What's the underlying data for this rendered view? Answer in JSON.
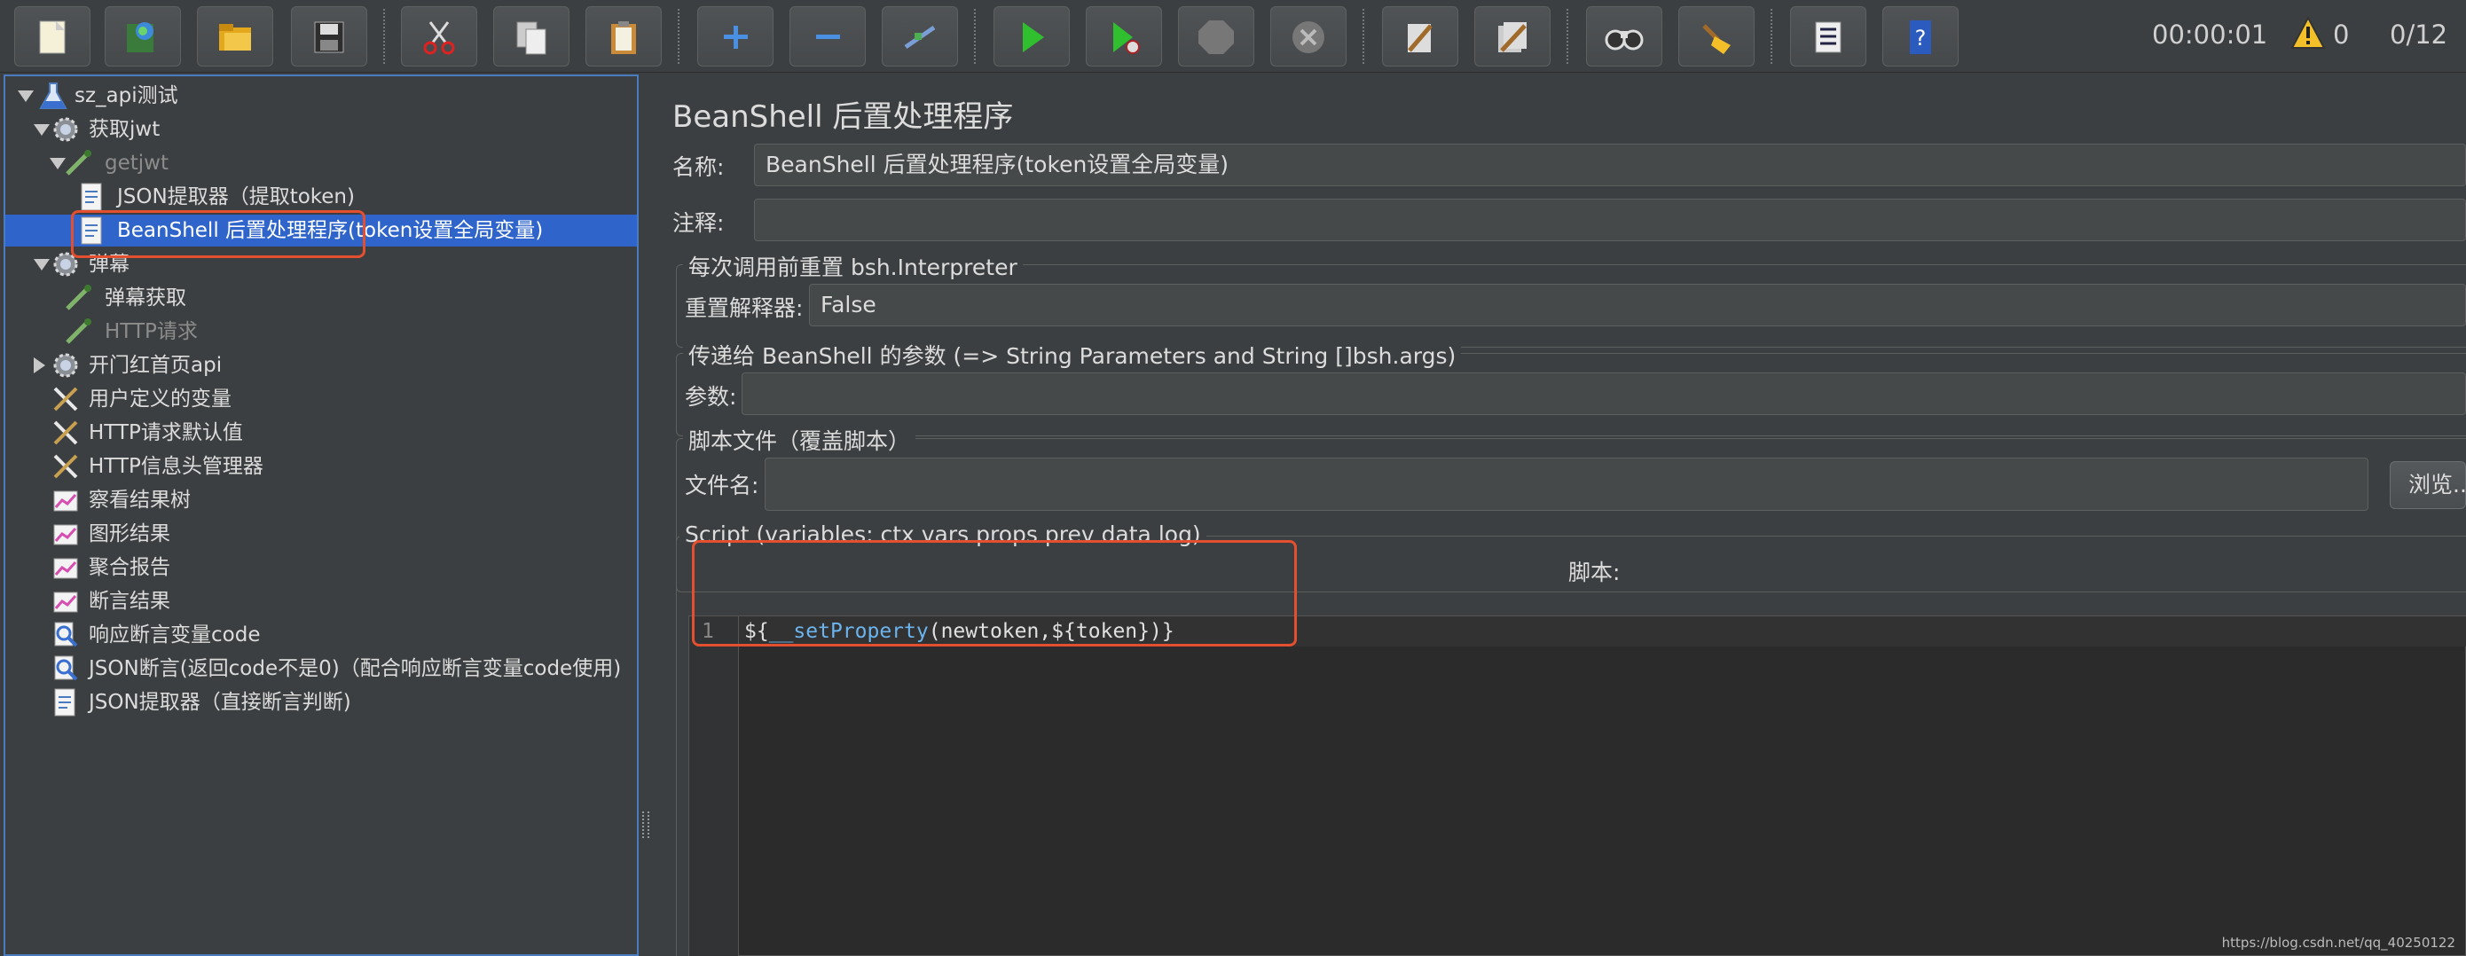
{
  "toolbar": {
    "buttons": [
      {
        "name": "new-plan-button",
        "icon": "new-document-icon"
      },
      {
        "name": "templates-button",
        "icon": "templates-icon"
      },
      {
        "name": "open-button",
        "icon": "open-folder-icon"
      },
      {
        "name": "save-button",
        "icon": "save-disk-icon"
      },
      {
        "name": "cut-button",
        "icon": "scissors-icon"
      },
      {
        "name": "copy-button",
        "icon": "copy-icon"
      },
      {
        "name": "paste-button",
        "icon": "paste-clipboard-icon"
      },
      {
        "name": "expand-button",
        "icon": "plus-icon"
      },
      {
        "name": "collapse-button",
        "icon": "minus-icon"
      },
      {
        "name": "toggle-button",
        "icon": "toggle-wand-icon"
      },
      {
        "name": "start-button",
        "icon": "play-icon"
      },
      {
        "name": "start-no-pauses-button",
        "icon": "play-no-timers-icon"
      },
      {
        "name": "stop-button",
        "icon": "stop-sign-icon"
      },
      {
        "name": "shutdown-button",
        "icon": "shutdown-x-icon"
      },
      {
        "name": "clear-button",
        "icon": "clear-broom-icon"
      },
      {
        "name": "clear-all-button",
        "icon": "clear-all-broom-icon"
      },
      {
        "name": "search-button",
        "icon": "binoculars-icon"
      },
      {
        "name": "reset-search-button",
        "icon": "reset-broom-icon"
      },
      {
        "name": "function-helper-button",
        "icon": "function-list-icon"
      },
      {
        "name": "help-button",
        "icon": "help-book-icon"
      }
    ],
    "timer": "00:00:01",
    "warning_count": "0",
    "threads": "0/12"
  },
  "tree": [
    {
      "label": "sz_api测试",
      "expanded": true,
      "icon": "flask-icon",
      "level": 0,
      "state": "normal"
    },
    {
      "label": "获取jwt",
      "expanded": true,
      "icon": "gear-icon",
      "level": 1,
      "state": "normal"
    },
    {
      "label": "getjwt",
      "expanded": true,
      "icon": "pipette-icon",
      "level": 2,
      "state": "disabled"
    },
    {
      "label": "JSON提取器（提取token)",
      "icon": "document-icon",
      "level": 3,
      "state": "normal"
    },
    {
      "label": "BeanShell 后置处理程序(token设置全局变量)",
      "icon": "document-icon",
      "level": 3,
      "state": "selected"
    },
    {
      "label": "弹幕",
      "expanded": true,
      "icon": "gear-icon",
      "level": 1,
      "state": "normal"
    },
    {
      "label": "弹幕获取",
      "icon": "pipette-icon",
      "level": 2,
      "state": "normal"
    },
    {
      "label": "HTTP请求",
      "icon": "pipette-icon",
      "level": 2,
      "state": "disabled"
    },
    {
      "label": "开门红首页api",
      "expanded": false,
      "icon": "gear-icon",
      "level": 1,
      "state": "normal"
    },
    {
      "label": "用户定义的变量",
      "icon": "tools-icon",
      "level": 1,
      "state": "normal"
    },
    {
      "label": "HTTP请求默认值",
      "icon": "tools-icon",
      "level": 1,
      "state": "normal"
    },
    {
      "label": "HTTP信息头管理器",
      "icon": "tools-icon",
      "level": 1,
      "state": "normal"
    },
    {
      "label": "察看结果树",
      "icon": "graph-icon",
      "level": 1,
      "state": "normal"
    },
    {
      "label": "图形结果",
      "icon": "graph-icon",
      "level": 1,
      "state": "normal"
    },
    {
      "label": "聚合报告",
      "icon": "graph-icon",
      "level": 1,
      "state": "normal"
    },
    {
      "label": "断言结果",
      "icon": "graph-icon",
      "level": 1,
      "state": "normal"
    },
    {
      "label": "响应断言变量code",
      "icon": "magnifier-icon",
      "level": 1,
      "state": "normal"
    },
    {
      "label": "JSON断言(返回code不是0)（配合响应断言变量code使用)",
      "icon": "magnifier-icon",
      "level": 1,
      "state": "normal"
    },
    {
      "label": "JSON提取器（直接断言判断)",
      "icon": "document-icon",
      "level": 1,
      "state": "normal"
    }
  ],
  "panel": {
    "title": "BeanShell 后置处理程序",
    "name_label": "名称:",
    "name_value": "BeanShell 后置处理程序(token设置全局变量)",
    "comment_label": "注释:",
    "comment_value": "",
    "reset_group_title": "每次调用前重置 bsh.Interpreter",
    "reset_label": "重置解释器:",
    "reset_value": "False",
    "params_group_title": "传递给 BeanShell 的参数 (=> String Parameters and String []bsh.args)",
    "params_label": "参数:",
    "params_value": "",
    "file_group_title": "脚本文件（覆盖脚本）",
    "file_label": "文件名:",
    "file_value": "",
    "browse_label": "浏览...",
    "script_group_title": "Script (variables: ctx vars props prev data log)",
    "script_header": "脚本:",
    "script_lines": [
      {
        "number": "1",
        "parts": {
          "p1": "${",
          "p2": "__setProperty",
          "p3": "(newtoken,",
          "p4": "${token}",
          "p5": ")}"
        }
      }
    ]
  },
  "colors": {
    "highlight": "#e4502f",
    "selection": "#2f65ca",
    "accent_border": "#4a7bbf"
  },
  "watermark": "https://blog.csdn.net/qq_40250122"
}
